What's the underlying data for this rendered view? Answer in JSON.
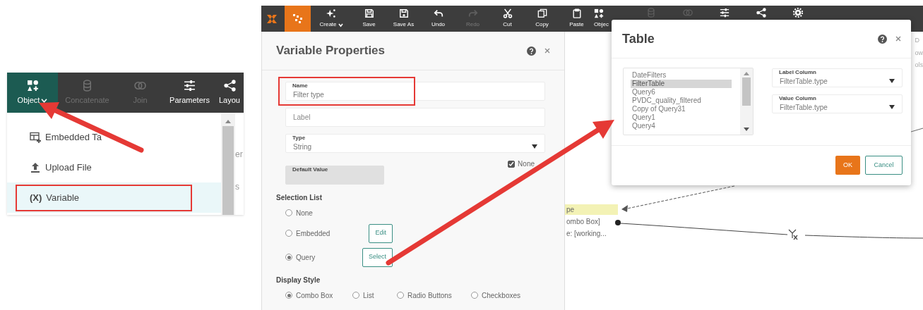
{
  "left_panel": {
    "toolbar": [
      {
        "label": "Object",
        "selected": true,
        "disabled": false,
        "dropdown": true
      },
      {
        "label": "Concatenate",
        "selected": false,
        "disabled": true,
        "dropdown": false
      },
      {
        "label": "Join",
        "selected": false,
        "disabled": true,
        "dropdown": false
      },
      {
        "label": "Parameters",
        "selected": false,
        "disabled": false,
        "dropdown": false
      },
      {
        "label": "Layou",
        "selected": false,
        "disabled": false,
        "dropdown": false
      }
    ],
    "menu": [
      {
        "label": "Embedded Ta",
        "selected": false
      },
      {
        "label": "Upload File",
        "selected": false
      },
      {
        "glyph": "(X)",
        "label": "Variable",
        "selected": true
      }
    ],
    "behind_text": [
      "er",
      "s"
    ]
  },
  "toolbar": [
    {
      "label": "Create",
      "dropdown": true,
      "disabled": false
    },
    {
      "label": "Save",
      "dropdown": false,
      "disabled": false
    },
    {
      "label": "Save As",
      "dropdown": false,
      "disabled": false
    },
    {
      "label": "Undo",
      "dropdown": false,
      "disabled": false
    },
    {
      "label": "Redo",
      "dropdown": false,
      "disabled": true
    },
    {
      "label": "Cut",
      "dropdown": false,
      "disabled": false
    },
    {
      "label": "Copy",
      "dropdown": false,
      "disabled": false
    },
    {
      "label": "Paste",
      "dropdown": false,
      "disabled": false
    },
    {
      "label": "Objec",
      "dropdown": false,
      "disabled": false
    },
    {
      "disabled": true
    },
    {
      "disabled": true
    },
    {
      "disabled": false
    },
    {
      "disabled": false
    },
    {
      "disabled": false
    }
  ],
  "variable_properties": {
    "title": "Variable Properties",
    "fields": [
      {
        "kind": "text",
        "label": "Name",
        "value": "Filter type"
      },
      {
        "kind": "text",
        "placeholder": "Label"
      },
      {
        "kind": "select",
        "label": "Type",
        "value": "String"
      },
      {
        "kind": "disabled",
        "label": "Default Value"
      }
    ],
    "none_checkbox": {
      "label": "None",
      "checked": true
    },
    "selection_list": {
      "heading": "Selection List",
      "options": [
        {
          "label": "None",
          "selected": false
        },
        {
          "label": "Embedded",
          "selected": false,
          "button": "Edit"
        },
        {
          "label": "Query",
          "selected": true,
          "button": "Select"
        }
      ]
    },
    "display_style": {
      "heading": "Display Style",
      "options": [
        {
          "label": "Combo Box",
          "selected": true
        },
        {
          "label": "List",
          "selected": false
        },
        {
          "label": "Radio Buttons",
          "selected": false
        },
        {
          "label": "Checkboxes",
          "selected": false
        }
      ]
    }
  },
  "diagram": {
    "node_rows": [
      {
        "text": "pe",
        "highlighted": true
      },
      {
        "text": "ombo Box]",
        "highlighted": false
      },
      {
        "text": "e: [working...",
        "highlighted": false
      }
    ],
    "edge_texts": [
      "D",
      "ow",
      "ols"
    ]
  },
  "table_dialog": {
    "title": "Table",
    "tables": [
      {
        "name": "DateFilters",
        "selected": false
      },
      {
        "name": "FilterTable",
        "selected": true
      },
      {
        "name": "Query6",
        "selected": false
      },
      {
        "name": "PVDC_quality_filtered",
        "selected": false
      },
      {
        "name": "Copy of Query31",
        "selected": false
      },
      {
        "name": "Query1",
        "selected": false
      },
      {
        "name": "Query4",
        "selected": false
      }
    ],
    "label_column": {
      "label": "Label Column",
      "value": "FilterTable.type"
    },
    "value_column": {
      "label": "Value Column",
      "value": "FilterTable.type"
    },
    "buttons": [
      {
        "label": "OK",
        "kind": "primary"
      },
      {
        "label": "Cancel",
        "kind": "secondary"
      }
    ]
  }
}
